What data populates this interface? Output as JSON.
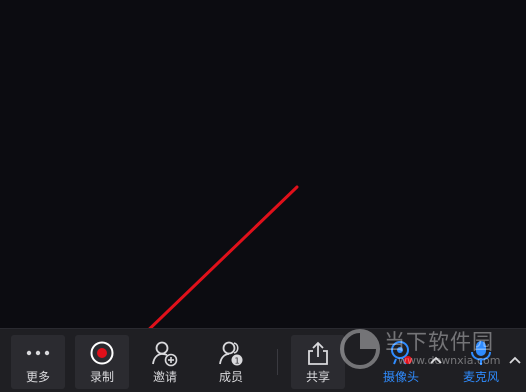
{
  "toolbar": {
    "more_label": "更多",
    "record_label": "录制",
    "invite_label": "邀请",
    "members_label": "成员",
    "share_label": "共享",
    "camera_label": "摄像头",
    "mic_label": "麦克风"
  },
  "watermark": {
    "brand": "当下软件园",
    "url": "www.downxia.com"
  },
  "colors": {
    "accent_blue": "#2f8cff",
    "record_red": "#e0101a",
    "arrow_red": "#e0101a"
  }
}
